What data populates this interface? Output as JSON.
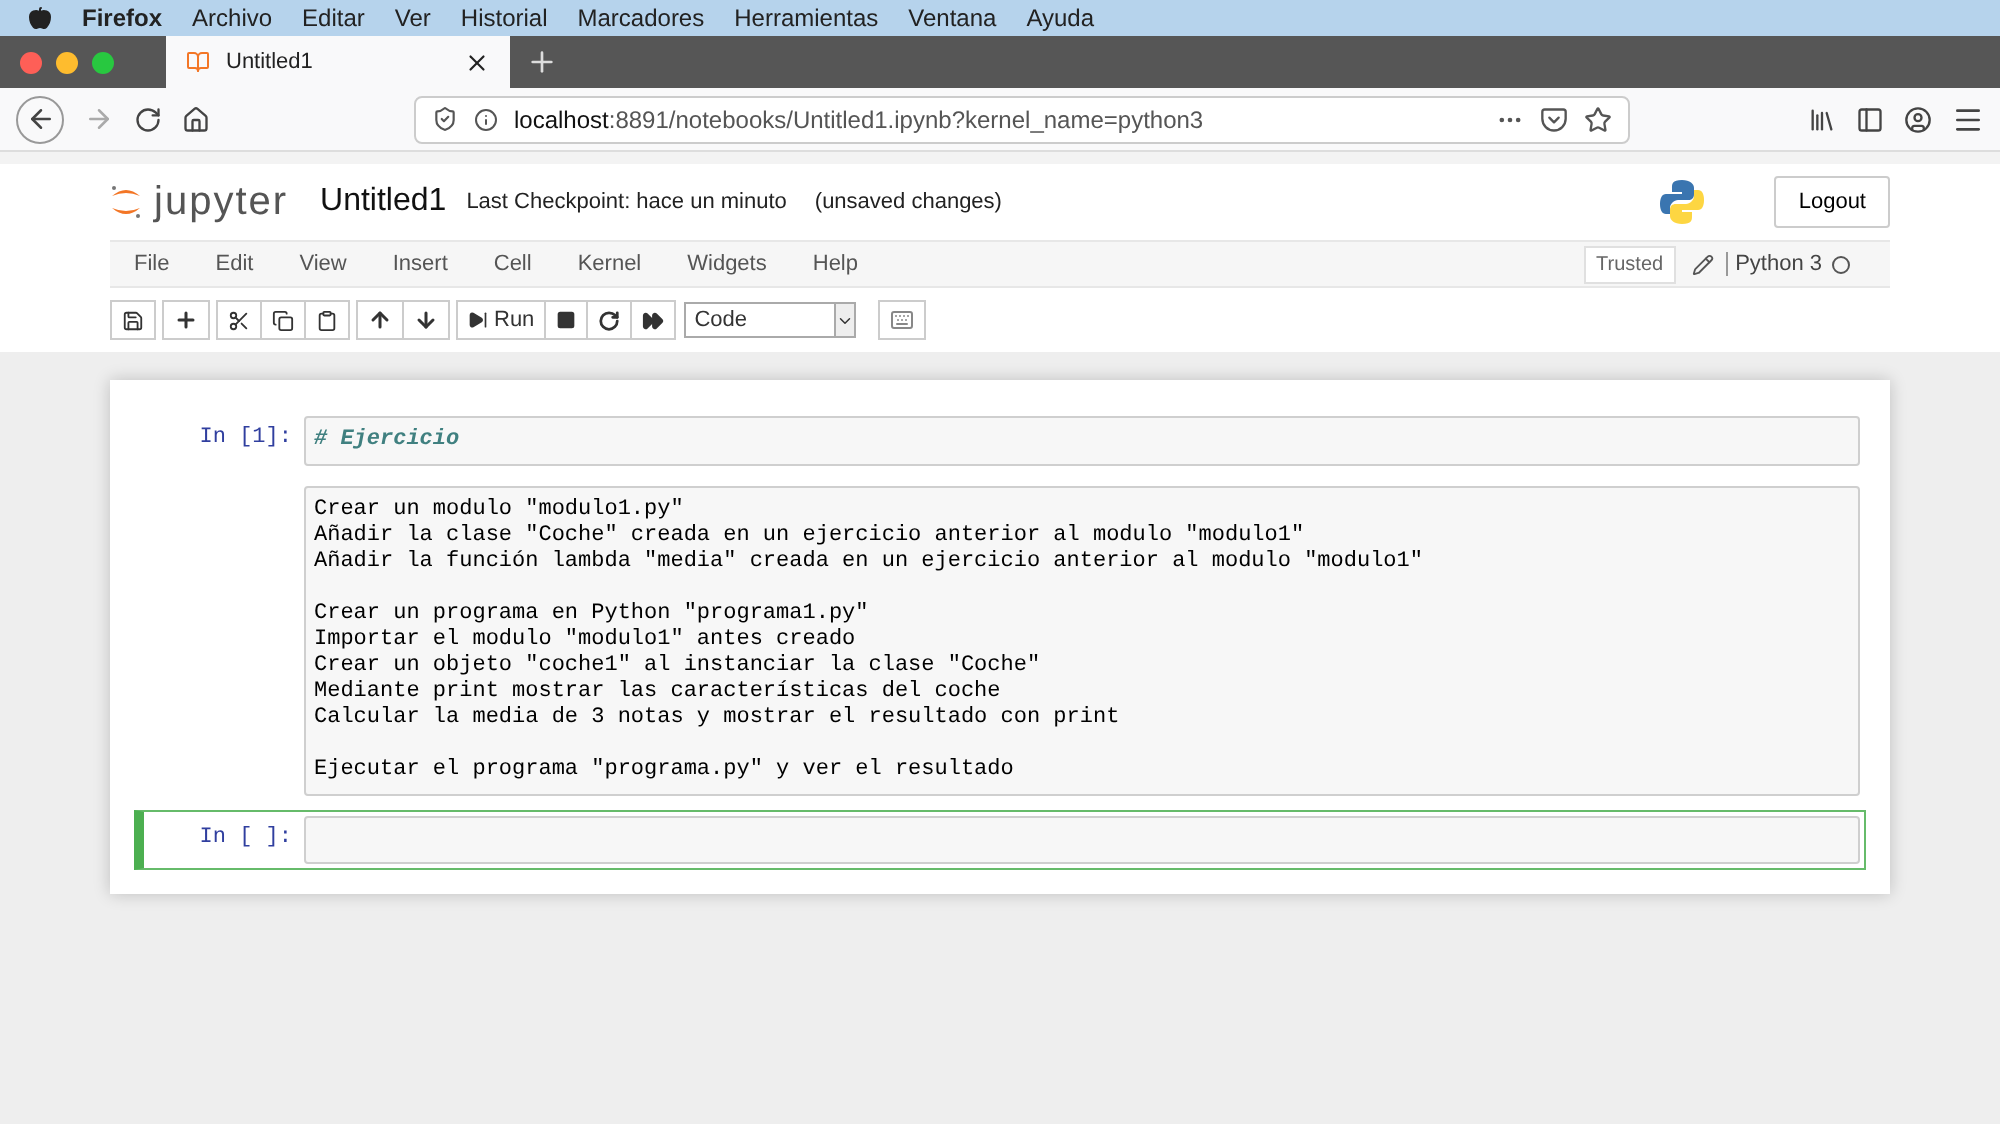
{
  "os_menu_bar": {
    "app_name": "Firefox",
    "items": [
      "Archivo",
      "Editar",
      "Ver",
      "Historial",
      "Marcadores",
      "Herramientas",
      "Ventana",
      "Ayuda"
    ]
  },
  "browser": {
    "tabs": [
      {
        "title": "Untitled1",
        "selected": true
      }
    ],
    "url_host": "localhost",
    "url_rest": ":8891/notebooks/Untitled1.ipynb?kernel_name=python3"
  },
  "notebook_header": {
    "logo_text": "jupyter",
    "name": "Untitled1",
    "checkpoint": "Last Checkpoint: hace un minuto",
    "unsaved": "(unsaved changes)",
    "logout": "Logout"
  },
  "menu": [
    "File",
    "Edit",
    "View",
    "Insert",
    "Cell",
    "Kernel",
    "Widgets",
    "Help"
  ],
  "trusted": "Trusted",
  "kernel": {
    "name": "Python 3",
    "busy": false
  },
  "toolbar": {
    "run_label": "Run",
    "cell_type": "Code"
  },
  "cells": [
    {
      "kind": "code",
      "prompt": "In [1]:",
      "selected": false,
      "source": "# Ejercicio"
    },
    {
      "kind": "raw",
      "selected": false,
      "blocks": [
        [
          "Crear un modulo \"modulo1.py\"",
          "Añadir la clase \"Coche\" creada en un ejercicio anterior al modulo \"modulo1\"",
          "Añadir la función lambda \"media\" creada en un ejercicio anterior al modulo \"modulo1\""
        ],
        [
          "Crear un programa en Python \"programa1.py\"",
          "Importar el modulo \"modulo1\" antes creado",
          "Crear un objeto \"coche1\" al instanciar la clase \"Coche\"",
          "Mediante print mostrar las características del coche",
          "Calcular la media de 3 notas y mostrar el resultado con print"
        ],
        [
          "Ejecutar el programa \"programa.py\" y ver el resultado"
        ]
      ]
    },
    {
      "kind": "code",
      "prompt": "In [ ]:",
      "selected": true
    }
  ]
}
